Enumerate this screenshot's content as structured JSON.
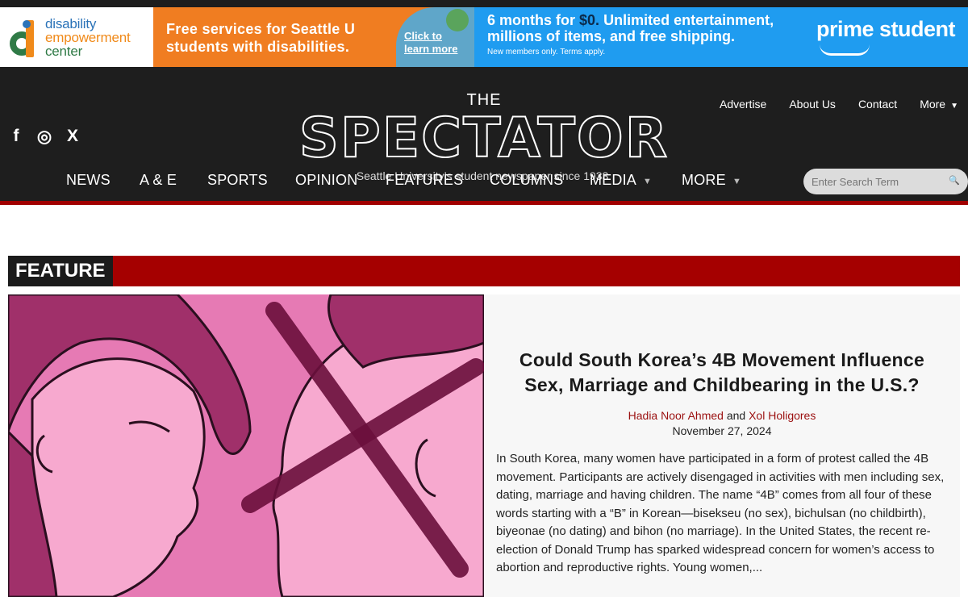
{
  "ads": {
    "disability": {
      "logo_lines": [
        "disability",
        "empowerment",
        "center"
      ],
      "headline_line1": "Free services for Seattle U",
      "headline_line2": "students with disabilities.",
      "cta_line1": "Click to",
      "cta_line2": "learn more"
    },
    "prime": {
      "line1_prefix": "6 months for",
      "line1_price": "$0.",
      "line1_suffix": "Unlimited entertainment,",
      "line2": "millions of items, and free shipping.",
      "fine_print": "New members only. Terms apply.",
      "brand": "prime student"
    }
  },
  "header": {
    "social": [
      {
        "icon": "facebook-icon",
        "glyph": "f"
      },
      {
        "icon": "instagram-icon",
        "glyph": "◎"
      },
      {
        "icon": "x-icon",
        "glyph": "X"
      }
    ],
    "logo": {
      "the": "THE",
      "name": "SPECTATOR",
      "tagline": "Seattle University’s student newspaper since 1933."
    },
    "top_nav": [
      "Advertise",
      "About Us",
      "Contact",
      "More"
    ],
    "main_nav": [
      "NEWS",
      "A & E",
      "SPORTS",
      "OPINION",
      "FEATURES",
      "COLUMNS",
      "MEDIA",
      "MORE"
    ],
    "search_placeholder": "Enter Search Term"
  },
  "feature": {
    "section_label": "FEATURE",
    "title_line1": "Could South Korea’s 4B Movement Influence",
    "title_line2": "Sex, Marriage and Childbearing in the U.S.?",
    "author1": "Hadia Noor Ahmed",
    "author_joiner": "and",
    "author2": "Xol Holigores",
    "date": "November 27, 2024",
    "excerpt": "In South Korea, many women have participated in a form of protest called the 4B movement. Participants are actively disengaged in activities with men including sex, dating, marriage and having children. The name “4B” comes from all four of these words starting with a “B” in Korean—bisekseu (no sex), bichulsan (no childbirth), biyeonae (no dating) and bihon (no marriage).  In the United States, the recent re-election of Donald Trump has sparked widespread concern for women’s access to abortion and reproductive rights. Young women,..."
  },
  "colors": {
    "header_bg": "#1e1e1e",
    "accent_red": "#a50000",
    "ad_orange": "#f07d21",
    "ad_blue": "#1f9cf0",
    "author_link": "#9b1010"
  }
}
